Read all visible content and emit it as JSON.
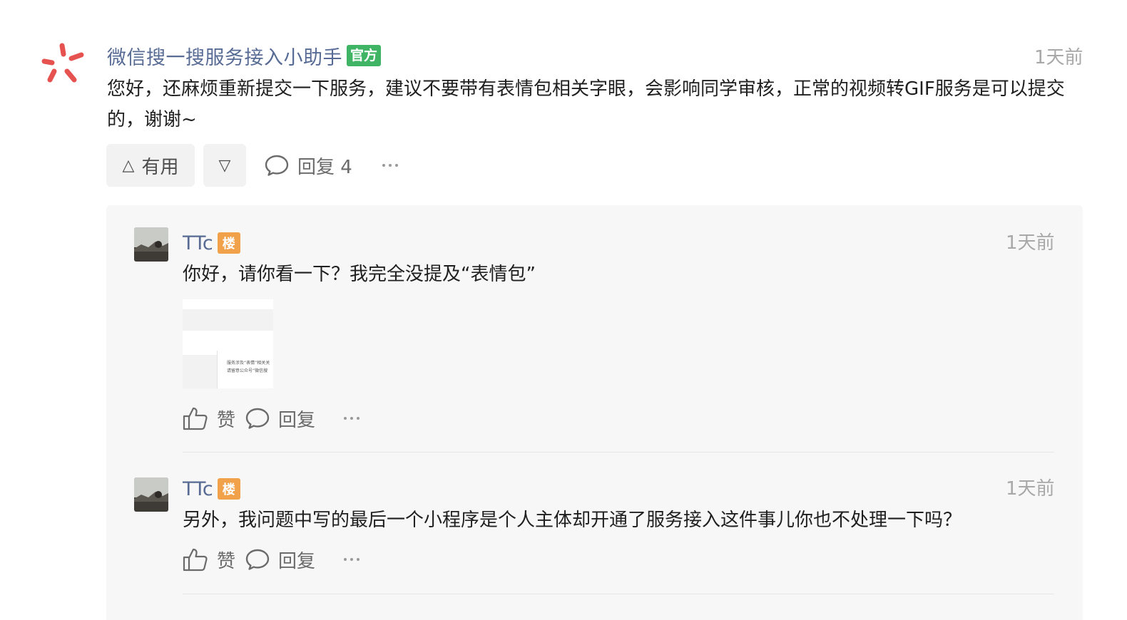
{
  "main_comment": {
    "author": "微信搜一搜服务接入小助手",
    "badge": "官方",
    "time": "1天前",
    "text": "您好，还麻烦重新提交一下服务，建议不要带有表情包相关字眼，会影响同学审核，正常的视频转GIF服务是可以提交的，谢谢~",
    "useful_label": "有用",
    "reply_label": "回复 4"
  },
  "replies": [
    {
      "author": "TTc",
      "badge": "楼",
      "time": "1天前",
      "text": "你好，请你看一下？我完全没提及“表情包”",
      "has_image": true,
      "image_lines": [
        "服务涉及“表情”相关关",
        "请留意公众号“微信搜"
      ],
      "like_label": "赞",
      "reply_label": "回复"
    },
    {
      "author": "TTc",
      "badge": "楼",
      "time": "1天前",
      "text": "另外，我问题中写的最后一个小程序是个人主体却开通了服务接入这件事儿你也不处理一下吗？",
      "has_image": false,
      "like_label": "赞",
      "reply_label": "回复"
    }
  ],
  "colors": {
    "author": "#576b95",
    "official_badge": "#3fb464",
    "floor_badge": "#f0a14a",
    "logo": "#e5524f"
  }
}
